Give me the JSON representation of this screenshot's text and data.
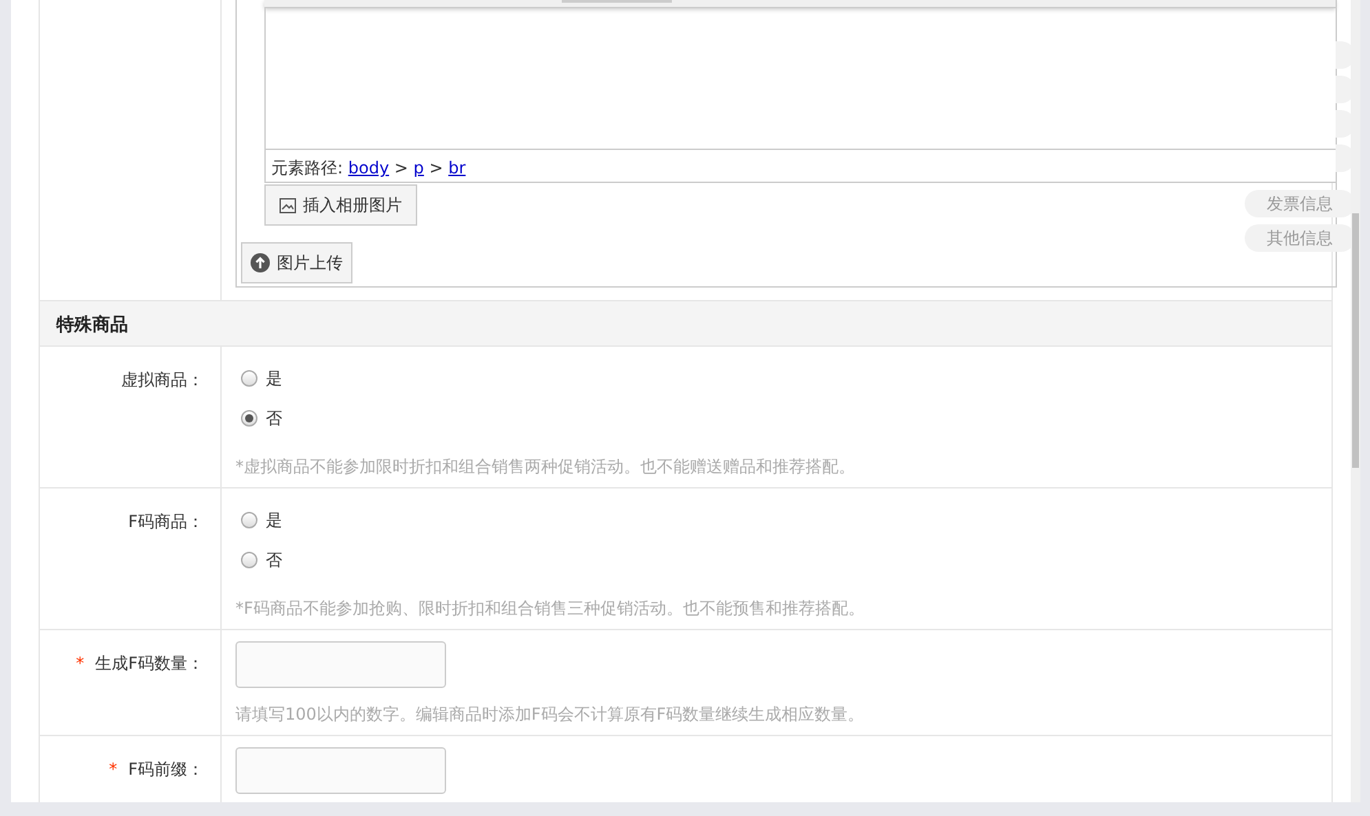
{
  "editor": {
    "path_label": "元素路径:",
    "path": [
      {
        "kind": "link",
        "text": "body"
      },
      {
        "kind": "sep",
        "text": ">"
      },
      {
        "kind": "link",
        "text": "p"
      },
      {
        "kind": "sep",
        "text": ">"
      },
      {
        "kind": "link",
        "text": "br"
      }
    ],
    "insert_album_button": "插入相册图片"
  },
  "upload_button": "图片上传",
  "side_nav": [
    {
      "kind": "covered"
    },
    {
      "kind": "covered"
    },
    {
      "kind": "covered"
    },
    {
      "kind": "covered"
    },
    {
      "kind": "tab",
      "label": "发票信息"
    },
    {
      "kind": "tab",
      "label": "其他信息"
    }
  ],
  "sections": [
    {
      "title": "特殊商品",
      "rows": [
        {
          "kind": "radio",
          "label": "虚拟商品：",
          "options": [
            {
              "label": "是",
              "selected": false
            },
            {
              "label": "否",
              "selected": true
            }
          ],
          "hint": "*虚拟商品不能参加限时折扣和组合销售两种促销活动。也不能赠送赠品和推荐搭配。"
        },
        {
          "kind": "radio",
          "label": "F码商品：",
          "options": [
            {
              "label": "是",
              "selected": false
            },
            {
              "label": "否",
              "selected": false
            }
          ],
          "hint": "*F码商品不能参加抢购、限时折扣和组合销售三种促销活动。也不能预售和推荐搭配。"
        },
        {
          "kind": "input",
          "required_mark": "*",
          "label": "生成F码数量：",
          "hint": "请填写100以内的数字。编辑商品时添加F码会不计算原有F码数量继续生成相应数量。"
        },
        {
          "kind": "input",
          "required_mark": "*",
          "label": "F码前缀："
        }
      ]
    }
  ]
}
